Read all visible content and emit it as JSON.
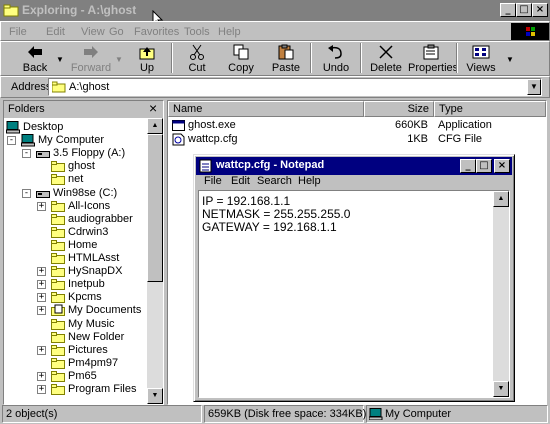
{
  "window": {
    "title": "Exploring - A:\\ghost",
    "controls": [
      "minimize",
      "maximize",
      "close"
    ]
  },
  "menubar": {
    "items": [
      "File",
      "Edit",
      "View",
      "Go",
      "Favorites",
      "Tools",
      "Help"
    ]
  },
  "toolbar": {
    "back": "Back",
    "forward": "Forward",
    "up": "Up",
    "cut": "Cut",
    "copy": "Copy",
    "paste": "Paste",
    "undo": "Undo",
    "delete": "Delete",
    "properties": "Properties",
    "views": "Views"
  },
  "address": {
    "label": "Address",
    "value": "A:\\ghost"
  },
  "folders": {
    "header": "Folders",
    "close": "×",
    "tree": [
      {
        "label": "Desktop",
        "icon": "desktop-icon"
      },
      {
        "label": "My Computer",
        "icon": "computer-icon"
      },
      {
        "label": "3.5 Floppy (A:)",
        "icon": "floppy-icon"
      },
      {
        "label": "ghost",
        "icon": "folder-open-icon"
      },
      {
        "label": "net",
        "icon": "folder-icon"
      },
      {
        "label": "Win98se (C:)",
        "icon": "drive-icon"
      },
      {
        "label": "All-Icons",
        "icon": "folder-icon"
      },
      {
        "label": "audiograbber",
        "icon": "folder-icon"
      },
      {
        "label": "Cdrwin3",
        "icon": "folder-icon"
      },
      {
        "label": "Home",
        "icon": "folder-icon"
      },
      {
        "label": "HTMLAsst",
        "icon": "folder-icon"
      },
      {
        "label": "HySnapDX",
        "icon": "folder-icon"
      },
      {
        "label": "Inetpub",
        "icon": "folder-icon"
      },
      {
        "label": "Kpcms",
        "icon": "folder-icon"
      },
      {
        "label": "My Documents",
        "icon": "documents-icon"
      },
      {
        "label": "My Music",
        "icon": "folder-icon"
      },
      {
        "label": "New Folder",
        "icon": "folder-icon"
      },
      {
        "label": "Pictures",
        "icon": "folder-icon"
      },
      {
        "label": "Pm4pm97",
        "icon": "folder-icon"
      },
      {
        "label": "Pm65",
        "icon": "folder-icon"
      },
      {
        "label": "Program Files",
        "icon": "folder-icon"
      }
    ]
  },
  "files": {
    "columns": [
      "Name",
      "Size",
      "Type"
    ],
    "rows": [
      {
        "name": "ghost.exe",
        "size": "660KB",
        "type": "Application"
      },
      {
        "name": "wattcp.cfg",
        "size": "1KB",
        "type": "CFG File"
      }
    ]
  },
  "notepad": {
    "title": "wattcp.cfg - Notepad",
    "menu": [
      "File",
      "Edit",
      "Search",
      "Help"
    ],
    "lines": [
      "IP = 192.168.1.1",
      "NETMASK = 255.255.255.0",
      "GATEWAY = 192.168.1.1"
    ]
  },
  "statusbar": {
    "objects": "2 object(s)",
    "disk": "659KB (Disk free space: 334KB)",
    "zone": "My Computer"
  },
  "colors": {
    "active_title": "#000080",
    "inactive_title": "#808080",
    "face": "#c0c0c0"
  }
}
